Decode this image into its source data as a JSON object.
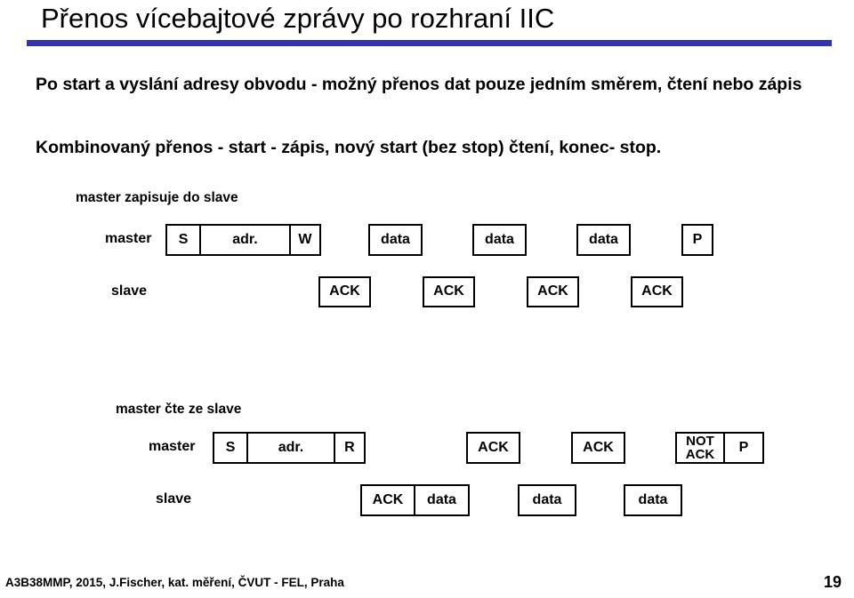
{
  "slide": {
    "title": "Přenos vícebajtové zprávy po rozhraní IIC",
    "rule_color": "#3333b0",
    "paragraphs": [
      "Po start  a vyslání adresy obvodu - možný přenos dat pouze jedním směrem, čtení nebo zápis",
      "Kombinovaný přenos - start - zápis, nový start (bez stop) čtení, konec- stop."
    ]
  },
  "diagram_write": {
    "caption": "master zapisuje do slave",
    "master_label": "master",
    "slave_label": "slave",
    "master_group": [
      "S",
      "adr.",
      "W"
    ],
    "master_boxes": [
      "data",
      "data",
      "data",
      "P"
    ],
    "slave_boxes": [
      "ACK",
      "ACK",
      "ACK",
      "ACK"
    ]
  },
  "diagram_read": {
    "caption": "master čte ze slave",
    "master_label": "master",
    "slave_label": "slave",
    "master_group": [
      "S",
      "adr.",
      "R"
    ],
    "master_boxes": [
      "ACK",
      "ACK"
    ],
    "master_end_group": [
      "NOT ACK",
      "P"
    ],
    "master_end_group_line1": "NOT",
    "master_end_group_line2": "ACK",
    "master_end_group_p": "P",
    "slave_group": [
      "ACK",
      "data"
    ],
    "slave_boxes": [
      "data",
      "data"
    ]
  },
  "footer": {
    "course": "A3B38MMP, 2015, J.Fischer, kat. měření, ČVUT - FEL, Praha",
    "page": "19"
  }
}
